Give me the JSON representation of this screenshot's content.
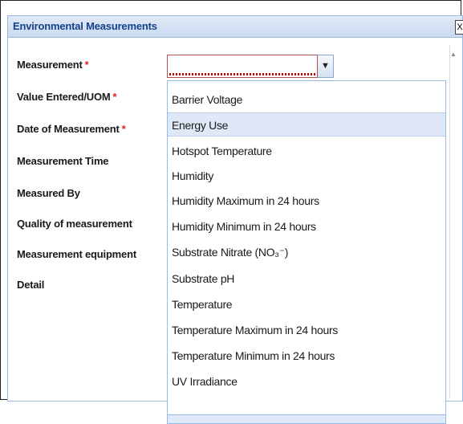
{
  "dialog": {
    "title": "Environmental Measurements",
    "close_label": "X"
  },
  "form": {
    "labels": [
      {
        "text": "Measurement",
        "required": true
      },
      {
        "text": "Value Entered/UOM",
        "required": true
      },
      {
        "text": "Date of Measurement",
        "required": true
      },
      {
        "text": "Measurement Time",
        "required": false
      },
      {
        "text": "Measured By",
        "required": false
      },
      {
        "text": "Quality of measurement",
        "required": false
      },
      {
        "text": "Measurement equipment",
        "required": false
      },
      {
        "text": "Detail",
        "required": false
      }
    ],
    "required_marker": "*",
    "measurement_value": "",
    "trigger_icon": "chevron-down-icon"
  },
  "dropdown": {
    "items": [
      "Barrier Voltage",
      "Energy Use",
      "Hotspot Temperature",
      "Humidity",
      "Humidity Maximum in 24 hours",
      "Humidity Minimum in 24 hours",
      "Substrate Nitrate (NO₃⁻)",
      "Substrate pH",
      "Temperature",
      "Temperature Maximum in 24 hours",
      "Temperature Minimum in 24 hours",
      "UV Irradiance"
    ],
    "highlighted_item": "Energy Use"
  },
  "colors": {
    "title_text": "#15428b",
    "highlight": "#dfe8f6",
    "required": "#e02020",
    "invalid_border": "#b05050"
  }
}
